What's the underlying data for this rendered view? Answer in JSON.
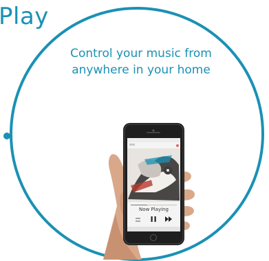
{
  "header": {
    "title": "Play"
  },
  "promo": {
    "tagline_line1": "Control your music from",
    "tagline_line2": "anywhere in your home"
  },
  "phone": {
    "now_playing_label": "Now Playing",
    "controls": [
      "shuffle-icon",
      "pause-icon",
      "fast-forward-icon"
    ]
  },
  "colors": {
    "accent": "#1a91b4",
    "phone_body": "#1e1e1e",
    "skin": "#d9a88a"
  }
}
